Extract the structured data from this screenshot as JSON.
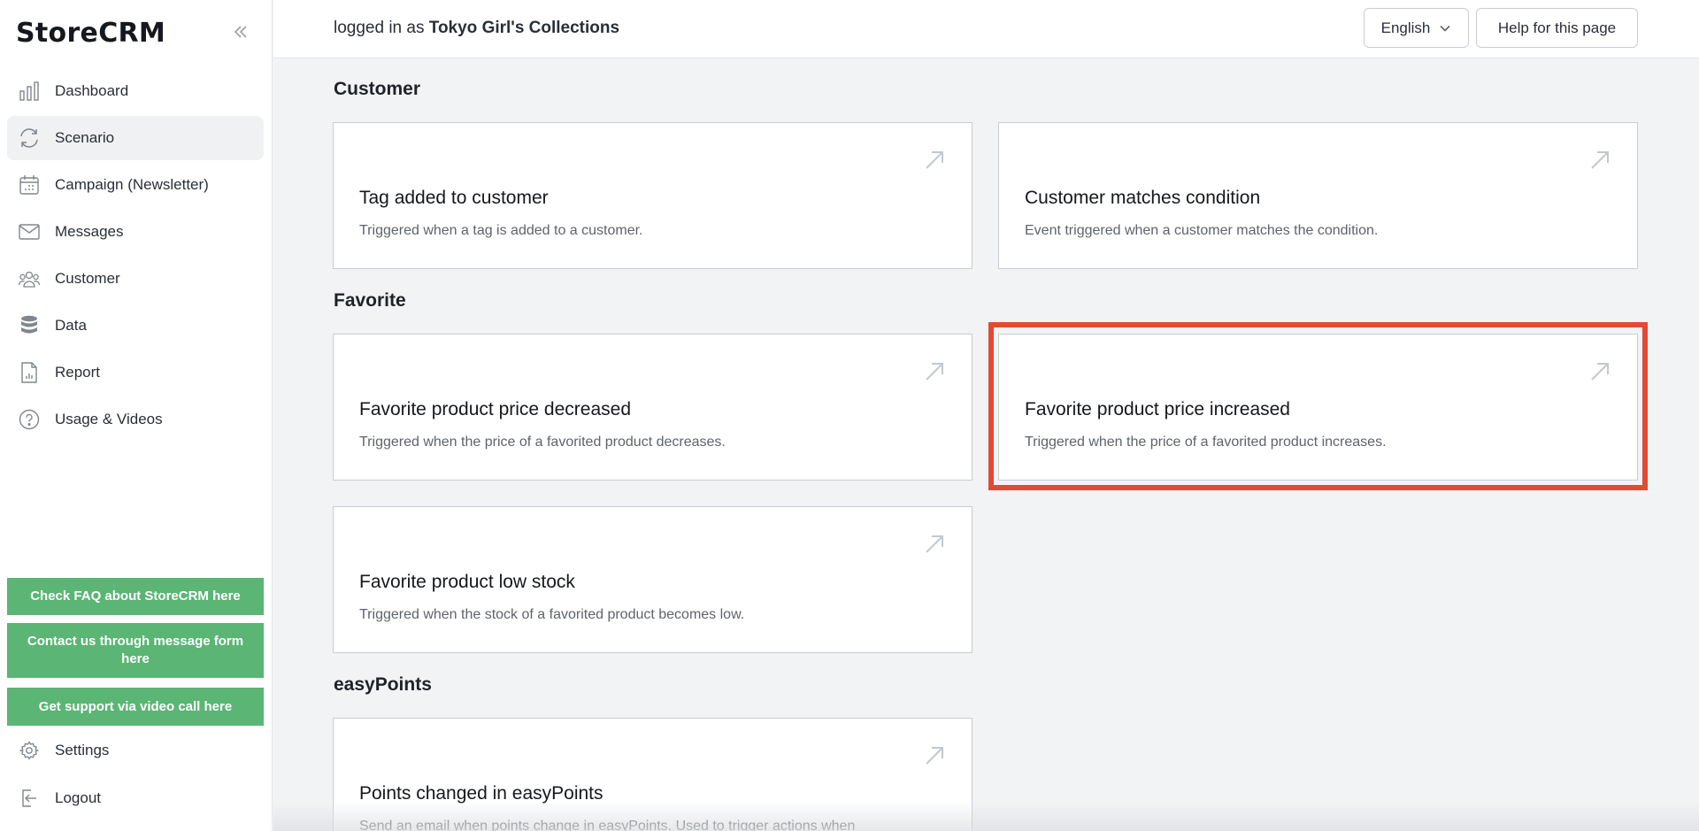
{
  "sidebar": {
    "brand": "StoreCRM",
    "nav": [
      {
        "label": "Dashboard",
        "icon": "bar-chart-icon"
      },
      {
        "label": "Scenario",
        "icon": "refresh-icon",
        "active": true
      },
      {
        "label": "Campaign (Newsletter)",
        "icon": "calendar-icon"
      },
      {
        "label": "Messages",
        "icon": "envelope-icon"
      },
      {
        "label": "Customer",
        "icon": "users-icon"
      },
      {
        "label": "Data",
        "icon": "database-icon"
      },
      {
        "label": "Report",
        "icon": "report-icon"
      },
      {
        "label": "Usage & Videos",
        "icon": "help-circle-icon"
      }
    ],
    "support": {
      "faq": "Check FAQ about StoreCRM here",
      "contact": "Contact us through message form here",
      "video": "Get support via video call here"
    },
    "settings": "Settings",
    "logout": "Logout"
  },
  "header": {
    "login_prefix": "logged in as",
    "store_name": "Tokyo Girl's Collections",
    "language": "English",
    "help": "Help for this page"
  },
  "sections": {
    "customer": {
      "title": "Customer",
      "cards": [
        {
          "title": "Tag added to customer",
          "desc": "Triggered when a tag is added to a customer."
        },
        {
          "title": "Customer matches condition",
          "desc": "Event triggered when a customer matches the condition."
        }
      ]
    },
    "favorite": {
      "title": "Favorite",
      "cards": [
        {
          "title": "Favorite product price decreased",
          "desc": "Triggered when the price of a favorited product decreases."
        },
        {
          "title": "Favorite product price increased",
          "desc": "Triggered when the price of a favorited product increases."
        },
        {
          "title": "Favorite product low stock",
          "desc": "Triggered when the stock of a favorited product becomes low."
        }
      ]
    },
    "easypoints": {
      "title": "easyPoints",
      "cards": [
        {
          "title": "Points changed in easyPoints",
          "desc": "Send an email when points change in easyPoints. Used to trigger actions when"
        }
      ]
    }
  },
  "colors": {
    "support_button": "#5bb574",
    "highlight": "#e34a35",
    "page_background": "#f2f3f5"
  }
}
